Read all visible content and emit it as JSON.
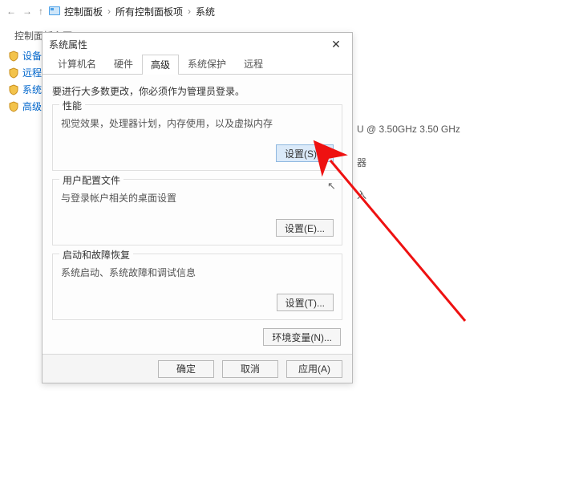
{
  "breadcrumb": {
    "arrows_left": [
      "←",
      "→",
      "↑"
    ],
    "items": [
      "控制面板",
      "所有控制面板项",
      "系统"
    ]
  },
  "sidebar": {
    "title": "控制面板主页",
    "items": [
      "设备管理",
      "远程设置",
      "系统保护",
      "高级系统"
    ]
  },
  "bg_sysinfo": {
    "cpu_tail": "U @ 3.50GHz   3.50 GHz",
    "line2": "器",
    "line3": "入"
  },
  "dialog": {
    "title": "系统属性",
    "tabs": [
      "计算机名",
      "硬件",
      "高级",
      "系统保护",
      "远程"
    ],
    "active_tab_index": 2,
    "note": "要进行大多数更改，你必须作为管理员登录。",
    "groups": [
      {
        "title": "性能",
        "desc": "视觉效果，处理器计划，内存使用，以及虚拟内存",
        "button": "设置(S)..."
      },
      {
        "title": "用户配置文件",
        "desc": "与登录帐户相关的桌面设置",
        "button": "设置(E)..."
      },
      {
        "title": "启动和故障恢复",
        "desc": "系统启动、系统故障和调试信息",
        "button": "设置(T)..."
      }
    ],
    "env_vars_button": "环境变量(N)...",
    "footer": {
      "ok": "确定",
      "cancel": "取消",
      "apply": "应用(A)"
    }
  }
}
